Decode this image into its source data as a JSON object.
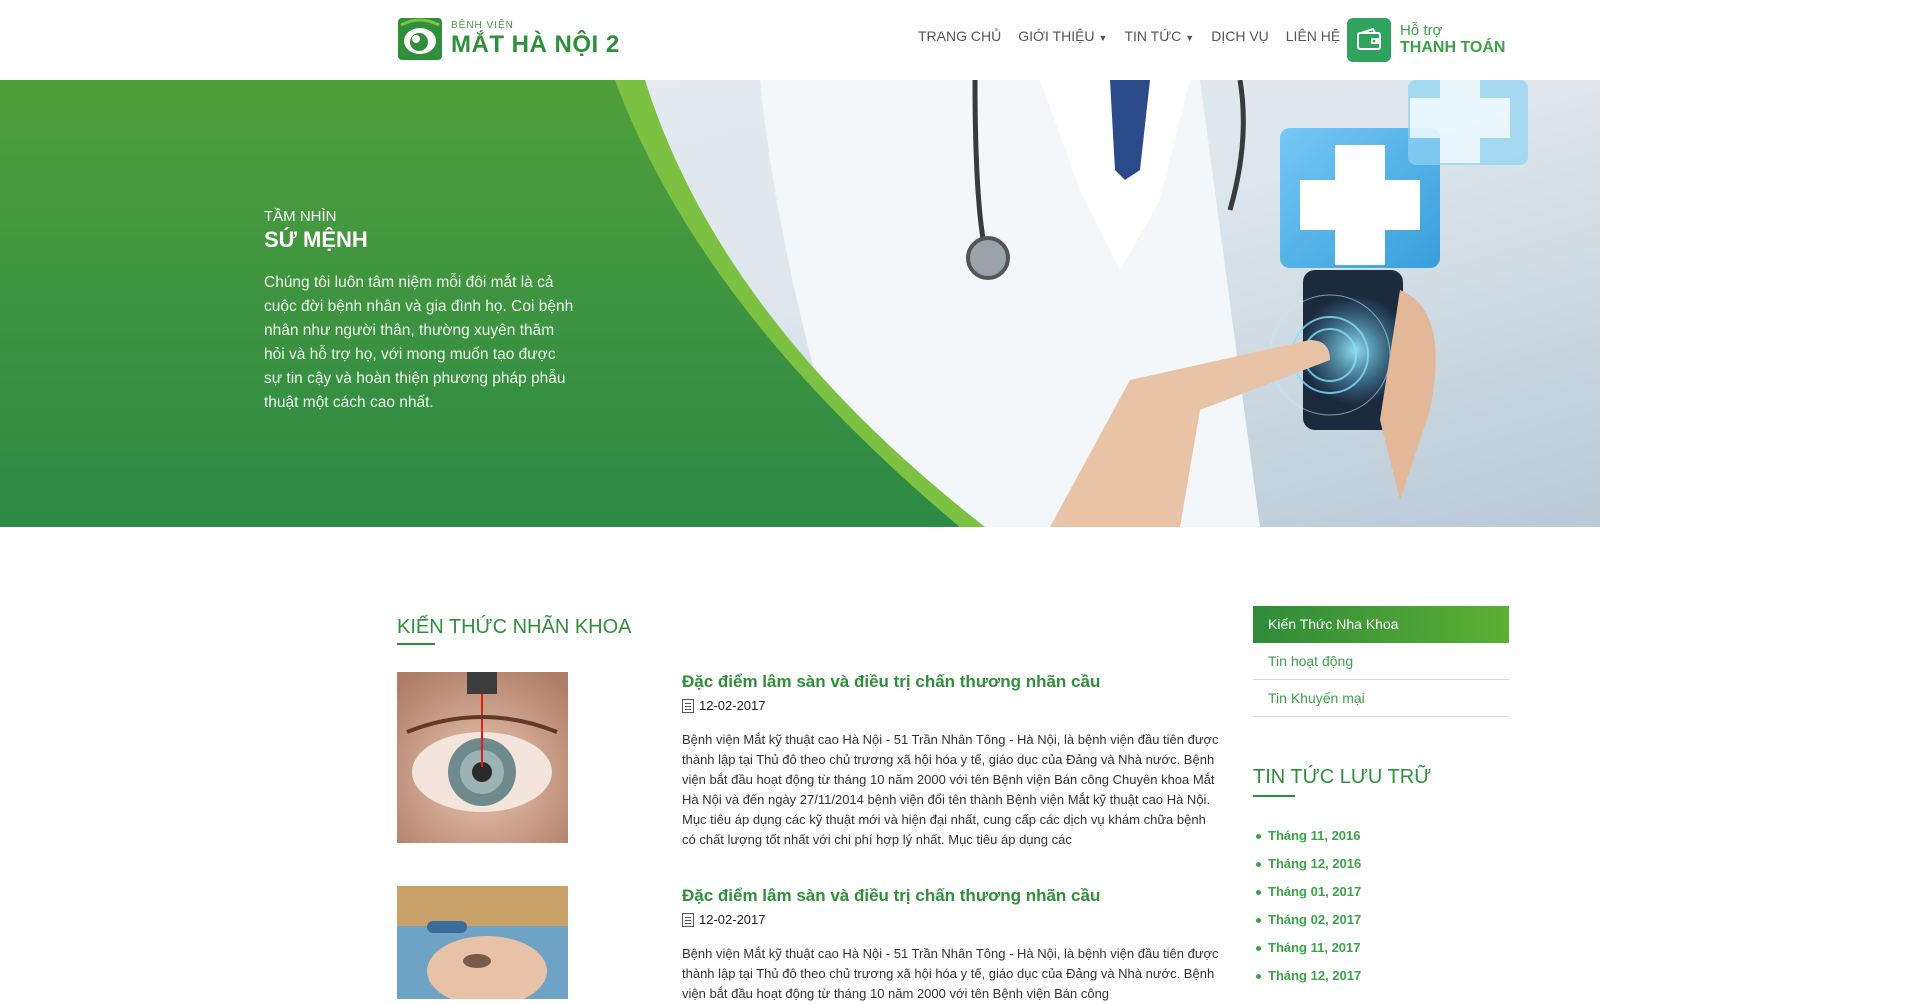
{
  "header": {
    "logo": {
      "small": "BỆNH VIỆN",
      "big": "MẮT HÀ NỘI 2"
    },
    "nav": [
      {
        "label": "TRANG CHỦ",
        "dropdown": false
      },
      {
        "label": "GIỚI THIỆU",
        "dropdown": true
      },
      {
        "label": "TIN TỨC",
        "dropdown": true
      },
      {
        "label": "DỊCH VỤ",
        "dropdown": false
      },
      {
        "label": "LIÊN HỆ",
        "dropdown": false
      }
    ],
    "support": {
      "line1": "Hỗ trợ",
      "line2": "THANH TOÁN",
      "icon": "wallet-icon"
    }
  },
  "hero": {
    "kicker": "TẦM NHÌN",
    "title": "SỨ MỆNH",
    "body": "Chúng tôi luôn tâm niệm mỗi đôi mắt là cả cuộc đời bệnh nhân và gia đình họ. Coi bệnh nhân như người thân, thường xuyên thăm hỏi và hỗ trợ họ, với mong muốn tạo được sự tin cậy và hoàn thiện phương pháp phẫu thuật một cách cao nhất."
  },
  "main": {
    "section_title": "KIẾN THỨC NHÃN KHOA",
    "articles": [
      {
        "title": "Đặc điểm lâm sàn và điều trị chấn thương nhãn cầu",
        "date": "12-02-2017",
        "excerpt": "Bệnh viện Mắt kỹ thuật cao Hà Nội - 51 Trần Nhân Tông - Hà Nội, là bệnh viện đầu tiên được thành lập tại Thủ đô theo chủ trương xã hội hóa y tế, giáo dục của Đảng và Nhà nước. Bệnh viện bắt đầu hoạt động từ tháng 10 năm 2000 với tên Bệnh viện Bán công Chuyên khoa Mắt Hà Nội và đến ngày 27/11/2014 bệnh viện đổi tên thành Bệnh viện Mắt kỹ thuật cao Hà Nội. Mục tiêu áp dụng các kỹ thuật mới và hiện đại nhất, cung cấp các dịch vụ khám chữa bệnh có chất lượng tốt nhất với chi phí hợp lý nhất. Mục tiêu áp dụng các"
      },
      {
        "title": "Đặc điểm lâm sàn và điều trị chấn thương nhãn cầu",
        "date": "12-02-2017",
        "excerpt": "Bệnh viện Mắt kỹ thuật cao Hà Nội - 51 Trần Nhân Tông - Hà Nội, là bệnh viện đầu tiên được thành lập tại Thủ đô theo chủ trương xã hội hóa y tế, giáo dục của Đảng và Nhà nước. Bệnh viện bắt đầu hoạt động từ tháng 10 năm 2000 với tên Bệnh viện Bán công"
      }
    ]
  },
  "sidebar": {
    "menu": [
      {
        "label": "Kiến Thức Nha Khoa",
        "active": true
      },
      {
        "label": "Tin hoạt động",
        "active": false
      },
      {
        "label": "Tin Khuyến mại",
        "active": false
      }
    ],
    "archive_title": "TIN TỨC LƯU TRỮ",
    "archive": [
      "Tháng 11, 2016",
      "Tháng 12, 2016",
      "Tháng 01, 2017",
      "Tháng 02, 2017",
      "Tháng 11, 2017",
      "Tháng 12, 2017"
    ]
  },
  "colors": {
    "brand_green": "#2f8f3a",
    "light_green": "#5cb033",
    "support_icon_bg": "#2fa35e"
  }
}
